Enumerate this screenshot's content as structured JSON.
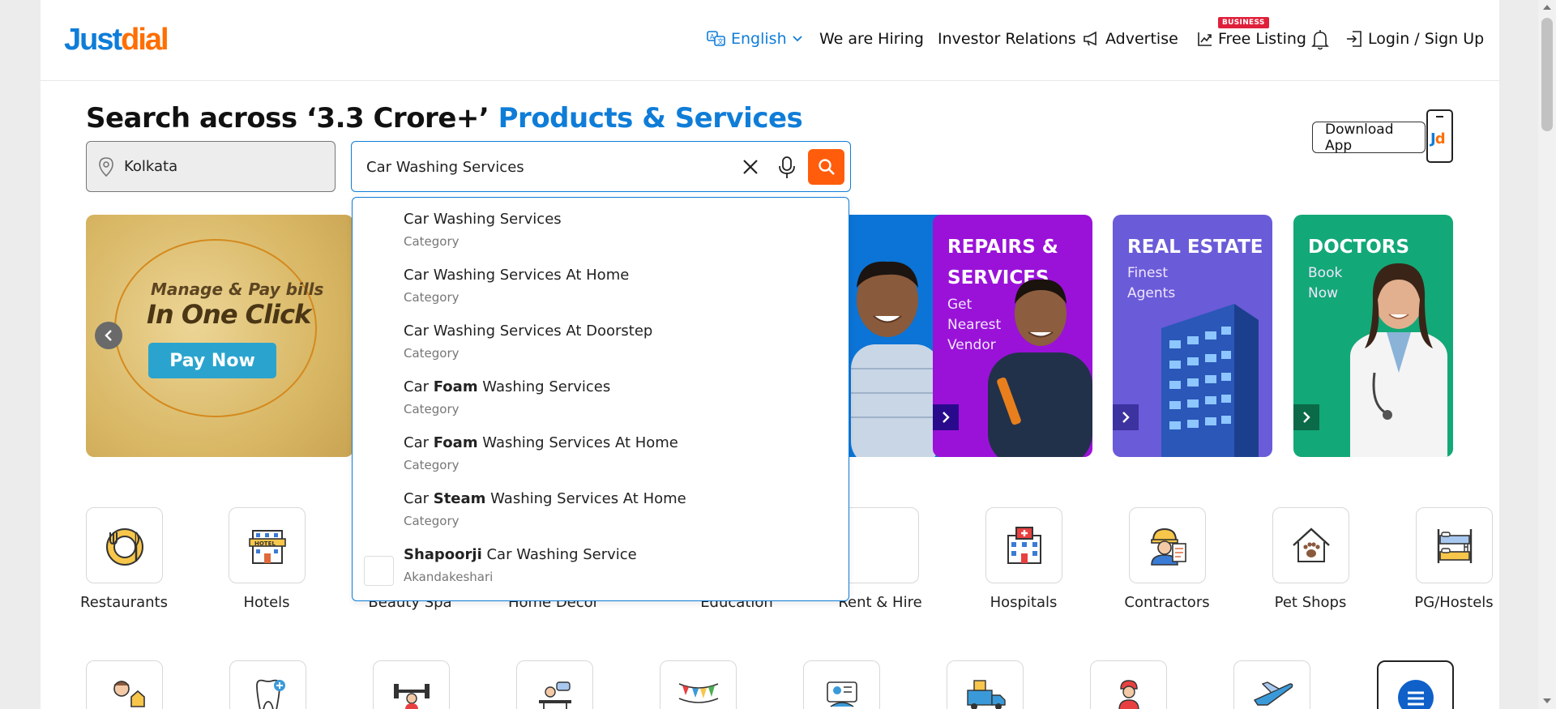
{
  "header": {
    "logo_part1": "Just",
    "logo_part2": "dial",
    "nav": {
      "language": "English",
      "hiring": "We are Hiring",
      "investor": "Investor Relations",
      "advertise": "Advertise",
      "free_listing_badge": "BUSINESS",
      "free_listing": "Free Listing",
      "login": "Login / Sign Up"
    }
  },
  "hero": {
    "title_part1": "Search across ‘3.3 Crore+’",
    "title_part2": "Products & Services",
    "location_value": "Kolkata",
    "search_value": "Car Washing Services",
    "download_app": "Download App",
    "app_logo_j": "J",
    "app_logo_d": "d"
  },
  "banners": {
    "pay_line1": "Manage & Pay bills",
    "pay_line2": "In One Click",
    "pay_button": "Pay Now",
    "repairs_title": "REPAIRS &",
    "repairs_title2": "SERVICES",
    "repairs_sub": "Get Nearest Vendor",
    "estate_title": "REAL ESTATE",
    "estate_sub": "Finest Agents",
    "doctors_title": "DOCTORS",
    "doctors_sub": "Book Now"
  },
  "suggestions": [
    {
      "pre": "Car Washing Services",
      "bold": "",
      "post": "",
      "sub": "Category"
    },
    {
      "pre": "Car Washing Services At Home",
      "bold": "",
      "post": "",
      "sub": "Category"
    },
    {
      "pre": "Car Washing Services At Doorstep",
      "bold": "",
      "post": "",
      "sub": "Category"
    },
    {
      "pre": "Car ",
      "bold": "Foam",
      "post": " Washing Services",
      "sub": "Category"
    },
    {
      "pre": "Car ",
      "bold": "Foam",
      "post": " Washing Services At Home",
      "sub": "Category"
    },
    {
      "pre": "Car ",
      "bold": "Steam",
      "post": " Washing Services At Home",
      "sub": "Category"
    },
    {
      "pre": "",
      "bold": "Shapoorji",
      "post": " Car Washing Service",
      "sub": "Akandakeshari"
    }
  ],
  "categories": [
    {
      "label": "Restaurants",
      "icon": "restaurant-icon"
    },
    {
      "label": "Hotels",
      "icon": "hotel-icon"
    },
    {
      "label": "Beauty Spa",
      "icon": "beauty-spa-icon"
    },
    {
      "label": "Home Decor",
      "icon": "home-decor-icon"
    },
    {
      "label": "Education",
      "icon": "education-icon"
    },
    {
      "label": "Rent & Hire",
      "icon": "rent-hire-icon"
    },
    {
      "label": "Hospitals",
      "icon": "hospital-icon"
    },
    {
      "label": "Contractors",
      "icon": "contractor-icon"
    },
    {
      "label": "Pet Shops",
      "icon": "pet-shop-icon"
    },
    {
      "label": "PG/Hostels",
      "icon": "pg-hostel-icon"
    }
  ],
  "colors": {
    "brand_blue": "#0f7dd8",
    "brand_orange": "#ff6e00",
    "search_button": "#ff5d0c"
  }
}
